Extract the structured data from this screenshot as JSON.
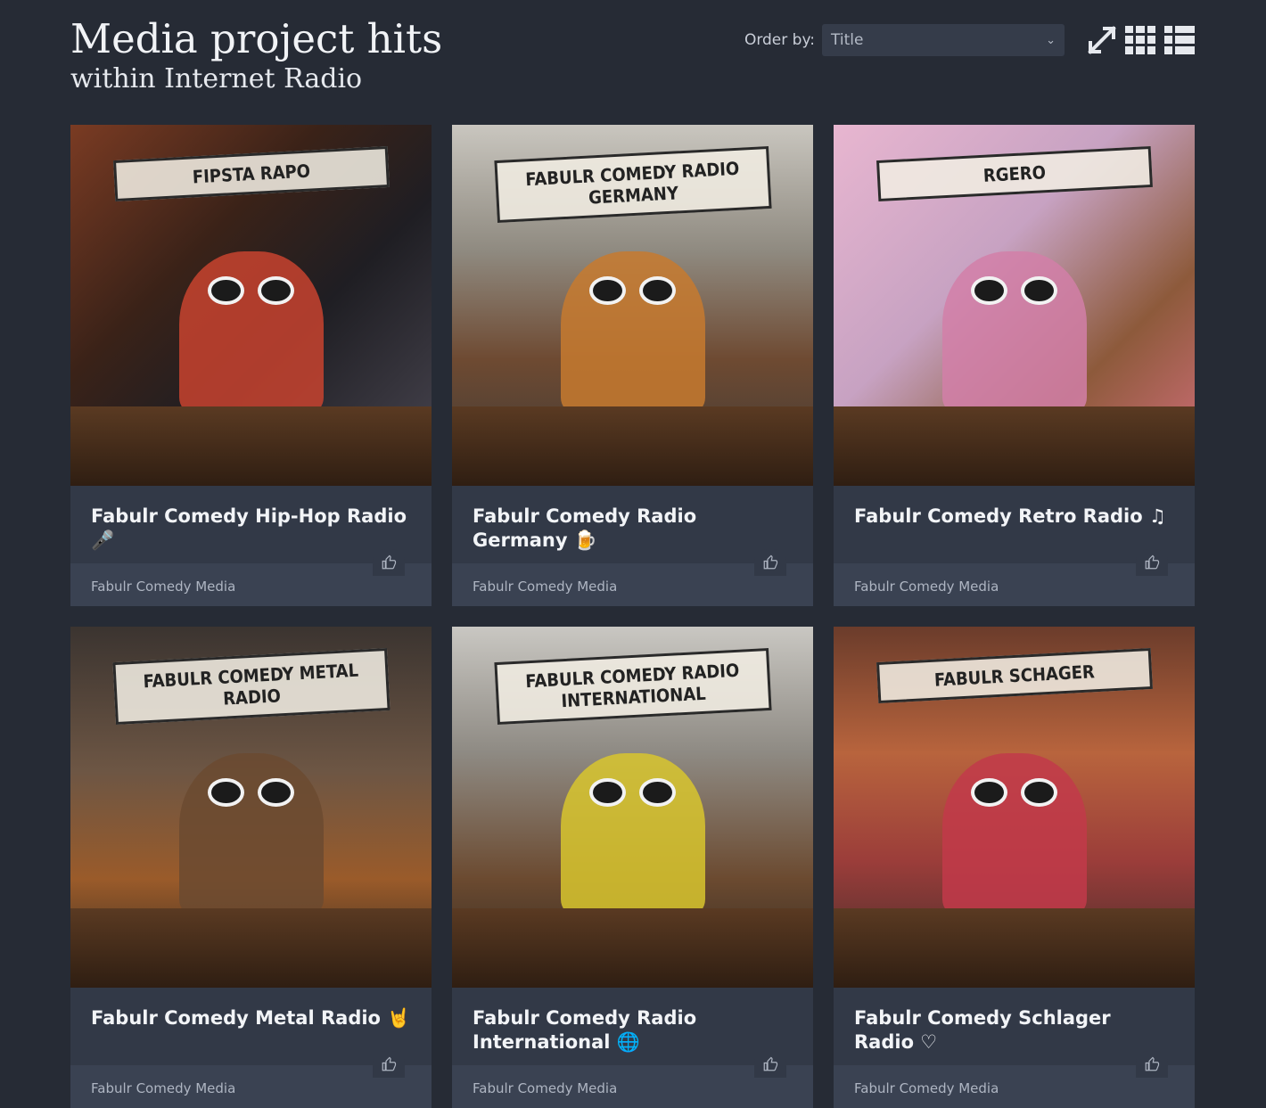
{
  "header": {
    "title": "Media project hits",
    "subtitle": "within Internet Radio"
  },
  "controls": {
    "order_label": "Order by:",
    "order_value": "Title",
    "icons": [
      "expand-icon",
      "grid-view-icon",
      "list-view-icon"
    ]
  },
  "cards": [
    {
      "name": "Fabulr Comedy Hip-Hop Radio 🎤",
      "publisher": "Fabulr Comedy Media",
      "art_text": "FIPSTA RAPO",
      "accent": "#c8432f"
    },
    {
      "name": "Fabulr Comedy Radio Germany 🍺",
      "publisher": "Fabulr Comedy Media",
      "art_text": "FABULR COMEDY RADIO GERMANY",
      "accent": "#c77a2f"
    },
    {
      "name": "Fabulr Comedy Retro Radio ♫",
      "publisher": "Fabulr Comedy Media",
      "art_text": "RGERO",
      "accent": "#d27fa8"
    },
    {
      "name": "Fabulr Comedy Metal Radio 🤘",
      "publisher": "Fabulr Comedy Media",
      "art_text": "FABULR COMEDY METAL RADIO",
      "accent": "#6b4a30"
    },
    {
      "name": "Fabulr Comedy Radio International 🌐",
      "publisher": "Fabulr Comedy Media",
      "art_text": "FABULR COMEDY RADIO INTERNATIONAL",
      "accent": "#d8c52e"
    },
    {
      "name": "Fabulr Comedy Schlager Radio ♡",
      "publisher": "Fabulr Comedy Media",
      "art_text": "FABULR SCHAGER",
      "accent": "#c23a4a"
    }
  ]
}
